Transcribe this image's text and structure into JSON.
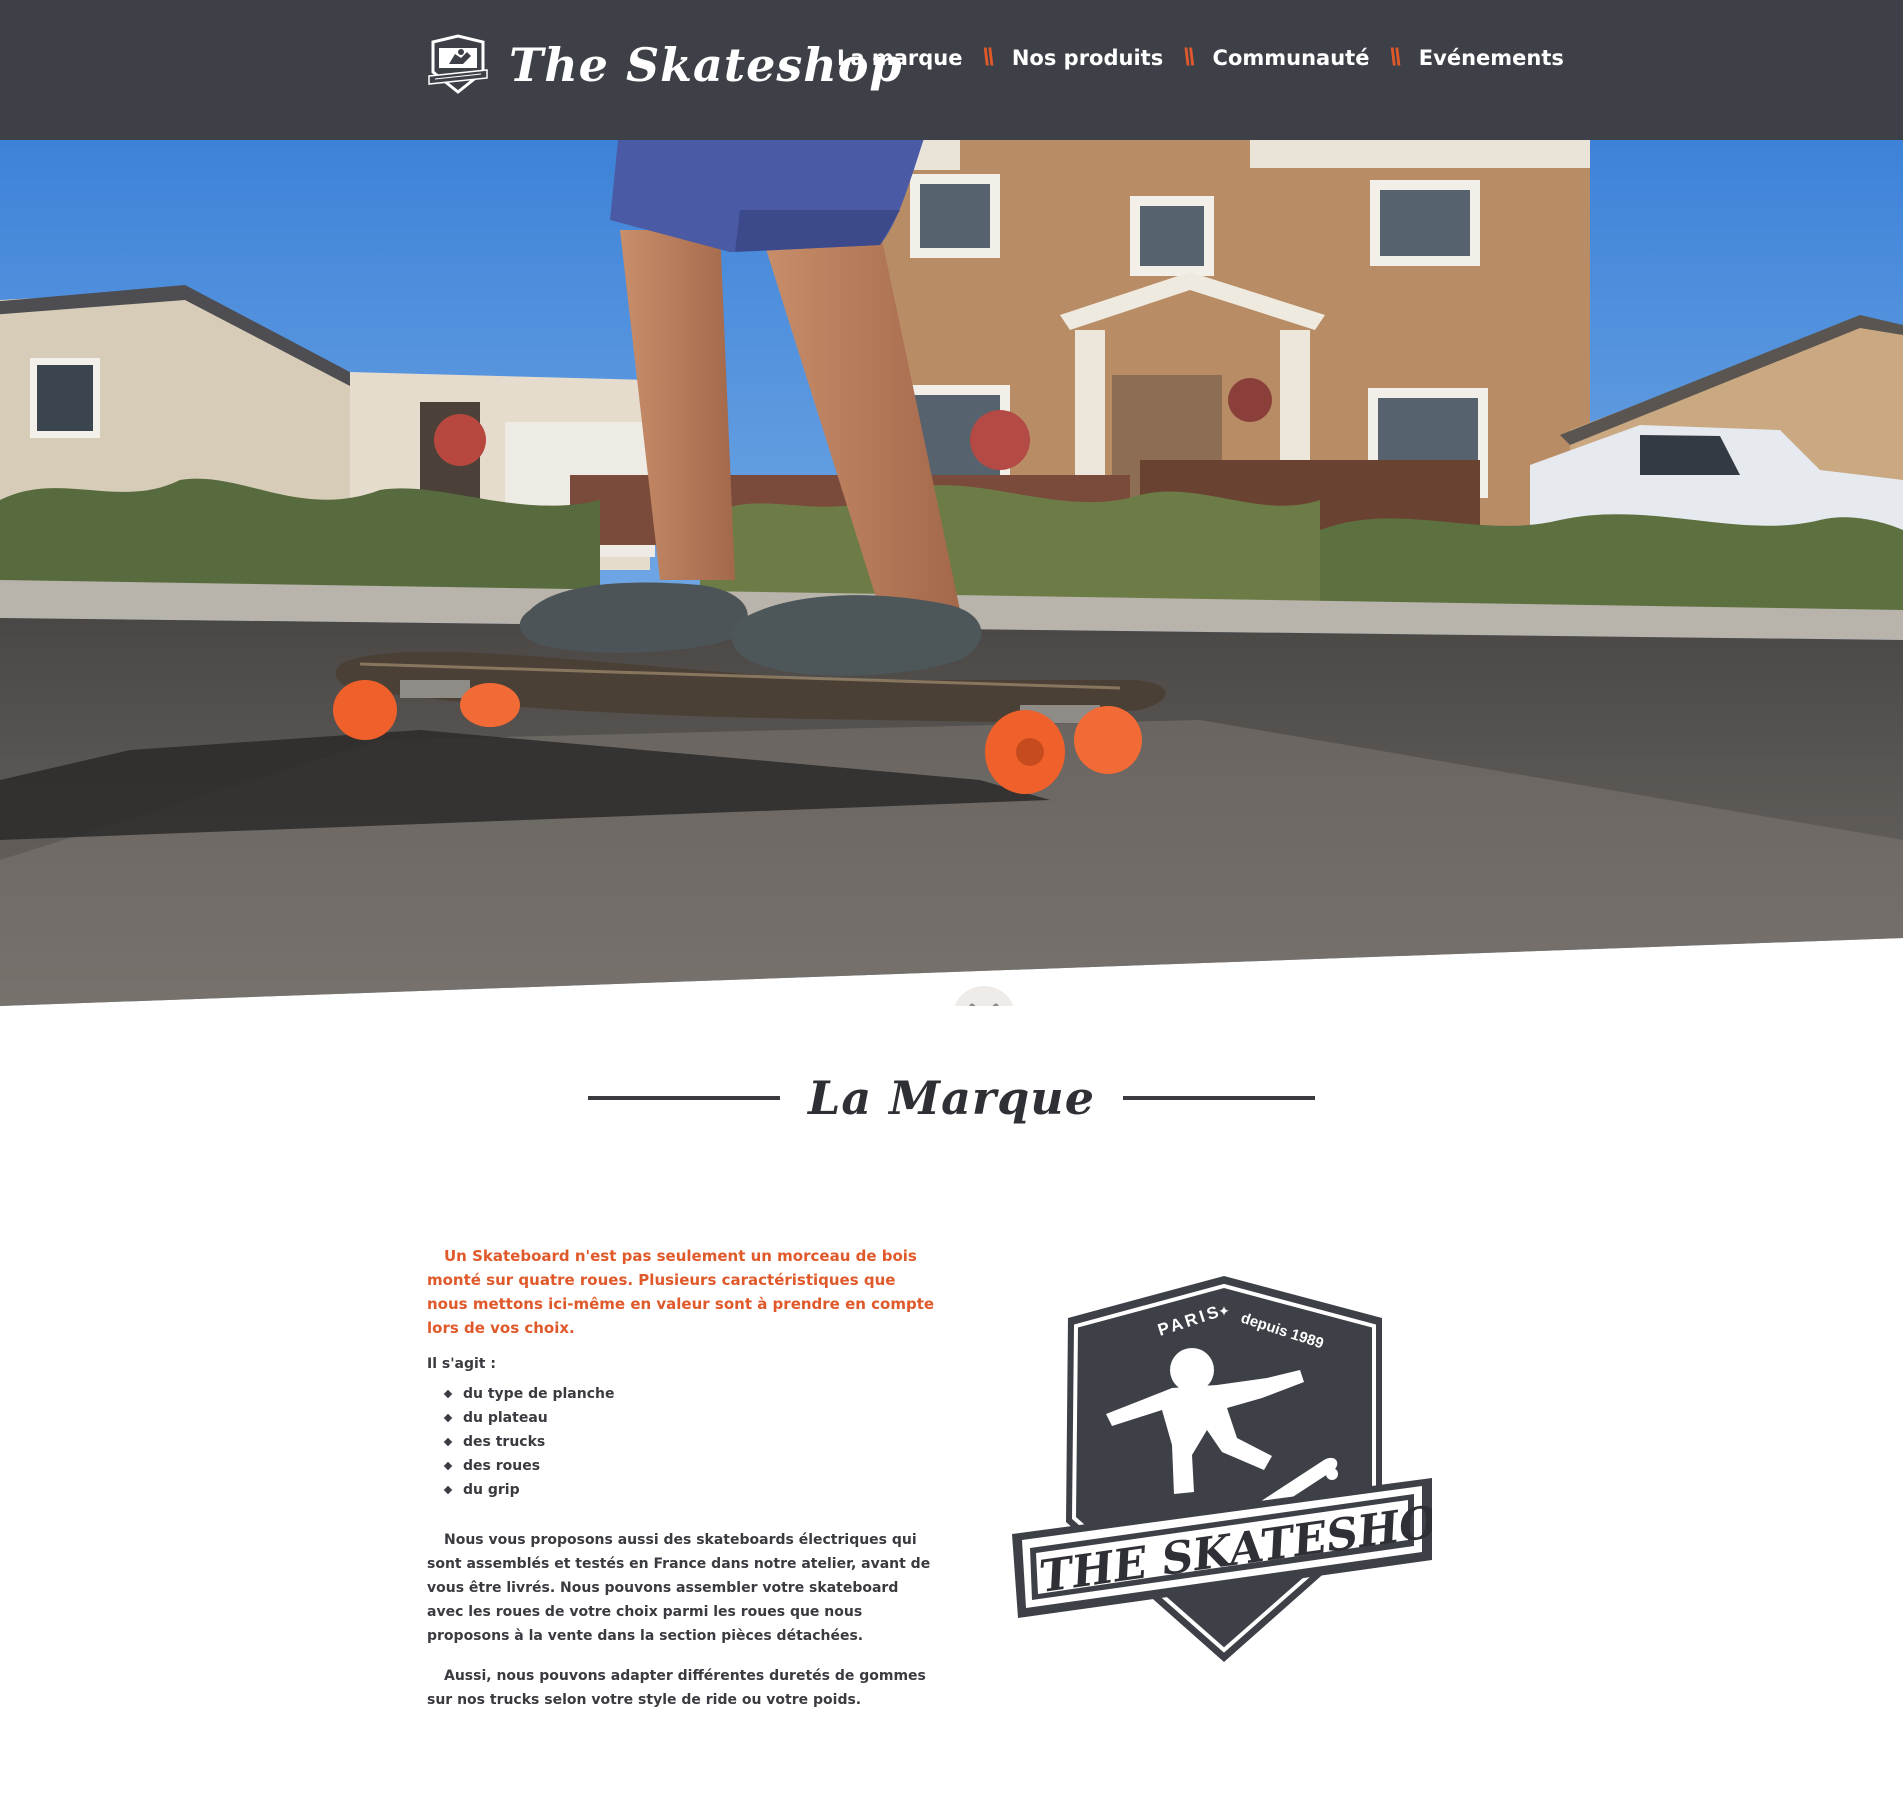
{
  "header": {
    "brand": "The Skateshop",
    "logo_badge_text": "PARIS + DEPUIS 1989",
    "nav": [
      {
        "label": "La marque"
      },
      {
        "label": "Nos produits"
      },
      {
        "label": "Communauté"
      },
      {
        "label": "Evénements"
      }
    ],
    "nav_separator": "\\\\"
  },
  "section": {
    "title": "La Marque"
  },
  "content": {
    "intro": "Un Skateboard n'est pas seulement un morceau de bois monté sur quatre roues. Plusieurs caractéristiques que nous mettons ici-même en valeur sont à prendre en compte lors de vos choix.",
    "lead": "Il s'agit :",
    "features": [
      "du type de planche",
      "du plateau",
      "des trucks",
      "des roues",
      "du grip"
    ],
    "paragraph_1": "Nous vous proposons aussi des skateboards électriques qui sont assemblés et testés en France dans notre atelier, avant de vous être livrés. Nous pouvons assembler votre skateboard avec les roues de votre choix parmi les roues que nous proposons à la vente dans la section pièces détachées.",
    "paragraph_2": "Aussi, nous pouvons adapter différentes duretés de gommes sur nos trucks selon votre style de ride ou votre poids."
  },
  "badge": {
    "top_left": "PARIS",
    "top_right": "depuis 1989",
    "banner": "THE SKATESHOP"
  },
  "colors": {
    "header_bg": "#3e4048",
    "accent": "#e0592a",
    "text": "#3a3b40",
    "wheel": "#f0602a"
  }
}
